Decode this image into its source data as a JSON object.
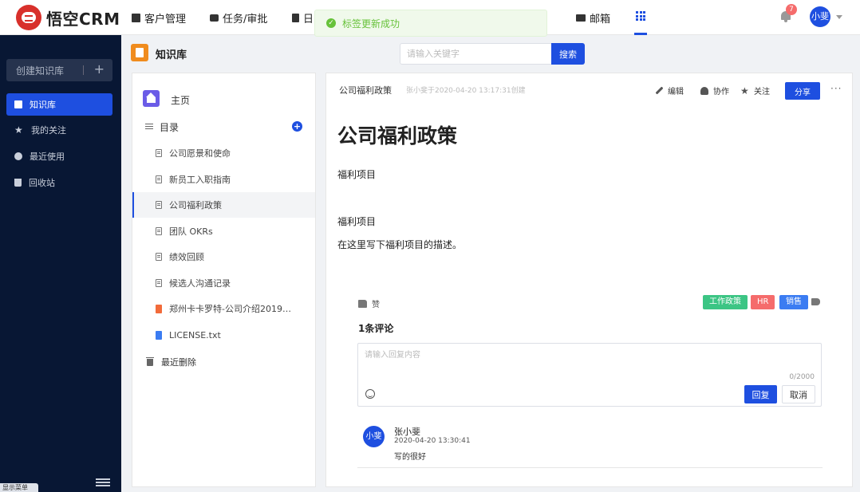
{
  "brand": {
    "name": "悟空CRM"
  },
  "nav": [
    {
      "label": "客户管理"
    },
    {
      "label": "任务/审批"
    },
    {
      "label": "日"
    },
    {
      "label": "邮箱"
    }
  ],
  "toast": {
    "message": "标签更新成功"
  },
  "notifications": {
    "count": "7"
  },
  "user": {
    "avatar_text": "小斐"
  },
  "sidebar": {
    "create_label": "创建知识库",
    "items": [
      {
        "label": "知识库"
      },
      {
        "label": "我的关注"
      },
      {
        "label": "最近使用"
      },
      {
        "label": "回收站"
      }
    ],
    "show_menu": "显示菜单"
  },
  "header": {
    "title": "知识库"
  },
  "search": {
    "placeholder": "请输入关键字",
    "button": "搜索"
  },
  "tree": {
    "home": "主页",
    "dir": "目录",
    "items": [
      {
        "label": "公司愿景和使命"
      },
      {
        "label": "新员工入职指南"
      },
      {
        "label": "公司福利政策"
      },
      {
        "label": "团队 OKRs"
      },
      {
        "label": "绩效回顾"
      },
      {
        "label": "候选人沟通记录"
      },
      {
        "label": "郑州卡卡罗特-公司介绍2019...."
      },
      {
        "label": "LICENSE.txt"
      }
    ],
    "recent_deleted": "最近删除"
  },
  "doc": {
    "name": "公司福利政策",
    "meta": "张小斐于2020-04-20 13:17:31创建",
    "tools": {
      "edit": "编辑",
      "collab": "协作",
      "follow": "关注",
      "share": "分享",
      "more": "···"
    },
    "title": "公司福利政策",
    "paragraphs": [
      "福利项目",
      "福利项目",
      "在这里写下福利项目的描述。"
    ],
    "like": "赞",
    "tags": [
      {
        "label": "工作政策",
        "color": "#3cc584"
      },
      {
        "label": "HR",
        "color": "#f56c6c"
      },
      {
        "label": "销售",
        "color": "#3b7cf2"
      }
    ]
  },
  "comments": {
    "title": "1条评论",
    "input_placeholder": "请输入回复内容",
    "counter": "0/2000",
    "reply": "回复",
    "cancel": "取消",
    "list": [
      {
        "avatar": "小斐",
        "name": "张小斐",
        "time": "2020-04-20 13:30:41",
        "text": "写的很好"
      }
    ]
  }
}
